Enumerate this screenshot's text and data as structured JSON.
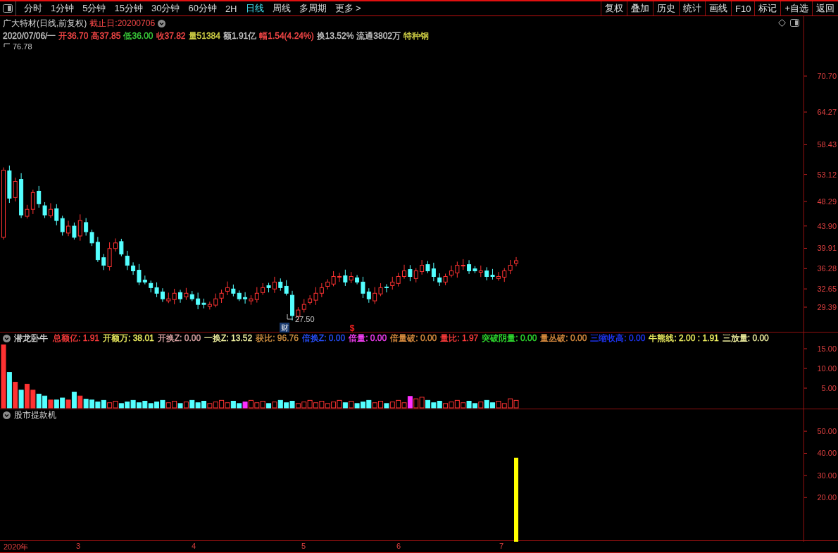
{
  "toolbar": {
    "periods": [
      {
        "label": "分时",
        "selected": false
      },
      {
        "label": "1分钟",
        "selected": false
      },
      {
        "label": "5分钟",
        "selected": false
      },
      {
        "label": "15分钟",
        "selected": false
      },
      {
        "label": "30分钟",
        "selected": false
      },
      {
        "label": "60分钟",
        "selected": false
      },
      {
        "label": "2H",
        "selected": false
      },
      {
        "label": "日线",
        "selected": true
      },
      {
        "label": "周线",
        "selected": false
      },
      {
        "label": "多周期",
        "selected": false
      },
      {
        "label": "更多 >",
        "selected": false
      }
    ],
    "buttons": [
      "复权",
      "叠加",
      "历史",
      "统计",
      "画线",
      "F10",
      "标记",
      "+自选",
      "返回"
    ]
  },
  "header": {
    "name": "广大特材(日线,前复权)",
    "end_date": "截止日:20200706",
    "quote": [
      {
        "text": "2020/07/06/一",
        "color": "#c8c8c8"
      },
      {
        "text": "开36.70",
        "color": "#ff4a4a"
      },
      {
        "text": "高37.85",
        "color": "#ff4a4a"
      },
      {
        "text": "低36.00",
        "color": "#3cd23c"
      },
      {
        "text": "收37.82",
        "color": "#ff4a4a"
      },
      {
        "text": "量51384",
        "color": "#d8d848"
      },
      {
        "text": "额1.91亿",
        "color": "#c8c8c8"
      },
      {
        "text": "幅1.54(4.24%)",
        "color": "#ff4a4a"
      },
      {
        "text": "换13.52%",
        "color": "#c8c8c8"
      },
      {
        "text": "流通3802万",
        "color": "#c8c8c8"
      },
      {
        "text": "特种钢",
        "color": "#d8d848"
      }
    ]
  },
  "price_chart": {
    "max_label": "76.78",
    "min_label": "27.50",
    "markers": [
      {
        "kind": "finance",
        "text": "财"
      },
      {
        "kind": "dividend",
        "text": "$"
      }
    ],
    "yaxis": [
      "70.70",
      "64.27",
      "58.43",
      "53.12",
      "48.29",
      "43.90",
      "39.91",
      "36.28",
      "32.65",
      "29.39"
    ]
  },
  "indicator": {
    "name": "潜龙卧牛",
    "values": [
      {
        "text": "总额亿: 1.91",
        "color": "#ff3c3c"
      },
      {
        "text": "开额万: 38.01",
        "color": "#f0f060"
      },
      {
        "text": "开换Z: 0.00",
        "color": "#e0a8a8"
      },
      {
        "text": "一换Z: 13.52",
        "color": "#f0f0a0"
      },
      {
        "text": "获比: 96.76",
        "color": "#d09040"
      },
      {
        "text": "倍换Z: 0.00",
        "color": "#2850ff"
      },
      {
        "text": "倍量: 0.00",
        "color": "#ff40ff"
      },
      {
        "text": "倍量破: 0.00",
        "color": "#e09040"
      },
      {
        "text": "量比: 1.97",
        "color": "#ff3c3c"
      },
      {
        "text": "突破阴量: 0.00",
        "color": "#30e030"
      },
      {
        "text": "量丛破: 0.00",
        "color": "#e09040"
      },
      {
        "text": "三缩收高: 0.00",
        "color": "#2038ff"
      },
      {
        "text": "牛熊线: 2.00 : 1.91",
        "color": "#f0f060"
      },
      {
        "text": "三放量: 0.00",
        "color": "#f0f0a0"
      }
    ],
    "yaxis": [
      "15.00",
      "10.00",
      "5.00"
    ]
  },
  "signal_panel": {
    "name": "股市提款机",
    "yaxis": [
      "50.00",
      "40.00",
      "30.00",
      "20.00"
    ]
  },
  "time_axis": [
    "2020年",
    "3",
    "4",
    "5",
    "6",
    "7"
  ]
}
